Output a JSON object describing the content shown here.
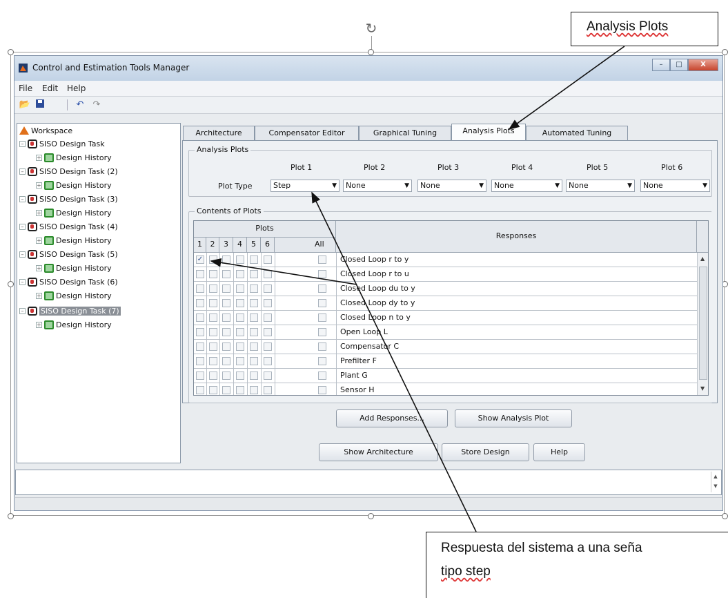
{
  "window": {
    "title": "Control and Estimation Tools Manager",
    "minimize_glyph": "–",
    "maximize_glyph": "□",
    "close_glyph": "X"
  },
  "menubar": {
    "items": [
      "File",
      "Edit",
      "Help"
    ]
  },
  "toolbar": {
    "icons": [
      "open-folder-icon",
      "save-icon",
      "undo-icon",
      "redo-icon"
    ]
  },
  "tree": {
    "root": "Workspace",
    "items": [
      {
        "label": "SISO Design Task",
        "child": "Design History"
      },
      {
        "label": "SISO Design Task (2)",
        "child": "Design History"
      },
      {
        "label": "SISO Design Task (3)",
        "child": "Design History"
      },
      {
        "label": "SISO Design Task (4)",
        "child": "Design History"
      },
      {
        "label": "SISO Design Task (5)",
        "child": "Design History"
      },
      {
        "label": "SISO Design Task (6)",
        "child": "Design History"
      },
      {
        "label": "SISO Design Task (7)",
        "child": "Design History",
        "selected": true
      }
    ]
  },
  "tabs": [
    "Architecture",
    "Compensator Editor",
    "Graphical Tuning",
    "Analysis Plots",
    "Automated Tuning"
  ],
  "active_tab": "Analysis Plots",
  "analysis_plots": {
    "group_title": "Analysis Plots",
    "plot_type_label": "Plot Type",
    "plots": [
      {
        "header": "Plot 1",
        "value": "Step"
      },
      {
        "header": "Plot 2",
        "value": "None"
      },
      {
        "header": "Plot 3",
        "value": "None"
      },
      {
        "header": "Plot 4",
        "value": "None"
      },
      {
        "header": "Plot 5",
        "value": "None"
      },
      {
        "header": "Plot 6",
        "value": "None"
      }
    ]
  },
  "contents": {
    "group_title": "Contents of Plots",
    "plots_header": "Plots",
    "plot_columns": [
      "1",
      "2",
      "3",
      "4",
      "5",
      "6",
      "All"
    ],
    "responses_header": "Responses",
    "rows": [
      {
        "response": "Closed Loop r to y",
        "checked_plot1": true
      },
      {
        "response": "Closed Loop r to u",
        "checked_plot1": false
      },
      {
        "response": "Closed Loop du to y",
        "checked_plot1": false
      },
      {
        "response": "Closed Loop dy to y",
        "checked_plot1": false
      },
      {
        "response": "Closed Loop n to y",
        "checked_plot1": false
      },
      {
        "response": "Open Loop L",
        "checked_plot1": false
      },
      {
        "response": "Compensator C",
        "checked_plot1": false
      },
      {
        "response": "Prefilter F",
        "checked_plot1": false
      },
      {
        "response": "Plant G",
        "checked_plot1": false
      },
      {
        "response": "Sensor H",
        "checked_plot1": false
      }
    ]
  },
  "buttons": {
    "add_responses": "Add Responses...",
    "show_analysis_plot": "Show Analysis Plot",
    "show_architecture": "Show Architecture",
    "store_design": "Store Design",
    "help": "Help"
  },
  "annotations": {
    "top_callout": "Analysis Plots",
    "bottom_callout_line1": "Respuesta del sistema a una seña",
    "bottom_callout_line2": "tipo step"
  }
}
